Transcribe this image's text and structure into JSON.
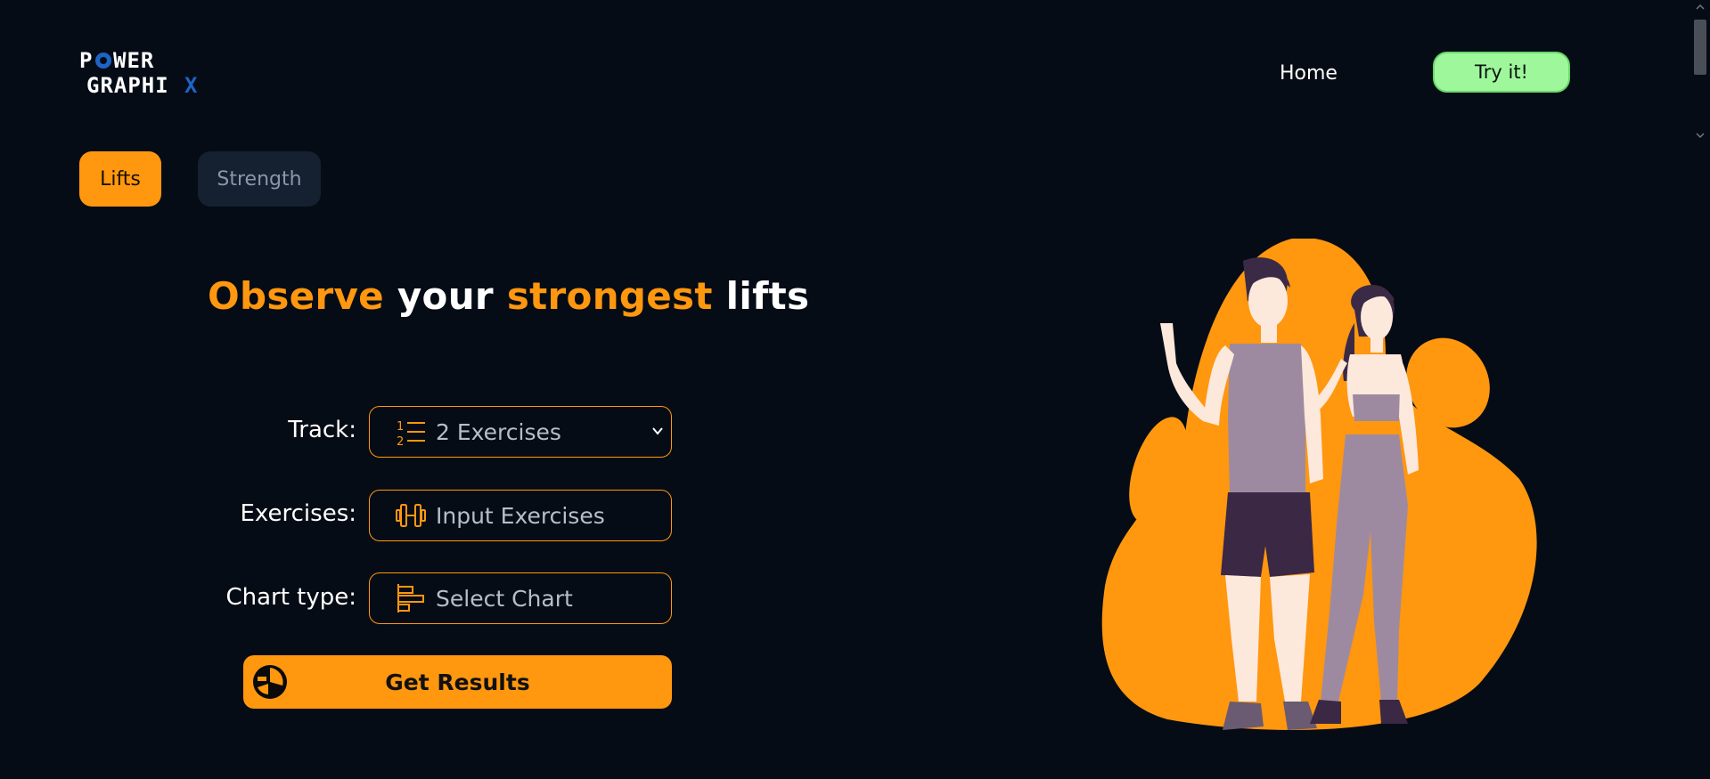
{
  "header": {
    "logo_line1": "POWER",
    "logo_line2": "GRAPHIX",
    "nav_home": "Home",
    "nav_try": "Try it!"
  },
  "tabs": [
    {
      "label": "Lifts",
      "active": true
    },
    {
      "label": "Strength",
      "active": false
    }
  ],
  "headline": {
    "word1": "Observe",
    "word2": "your",
    "word3": "strongest",
    "word4": "lifts"
  },
  "form": {
    "track_label": "Track:",
    "track_value": "2 Exercises",
    "track_icon": "numbered-list-icon",
    "exercises_label": "Exercises:",
    "exercises_placeholder": "Input Exercises",
    "exercises_icon": "dumbbell-icon",
    "chart_label": "Chart type:",
    "chart_placeholder": "Select Chart",
    "chart_icon": "bar-chart-icon",
    "submit_label": "Get Results",
    "submit_icon": "pie-chart-icon"
  },
  "colors": {
    "background": "#060c15",
    "accent": "#ff970f",
    "try_button": "#9ff79c",
    "inactive_tab": "#152030"
  }
}
